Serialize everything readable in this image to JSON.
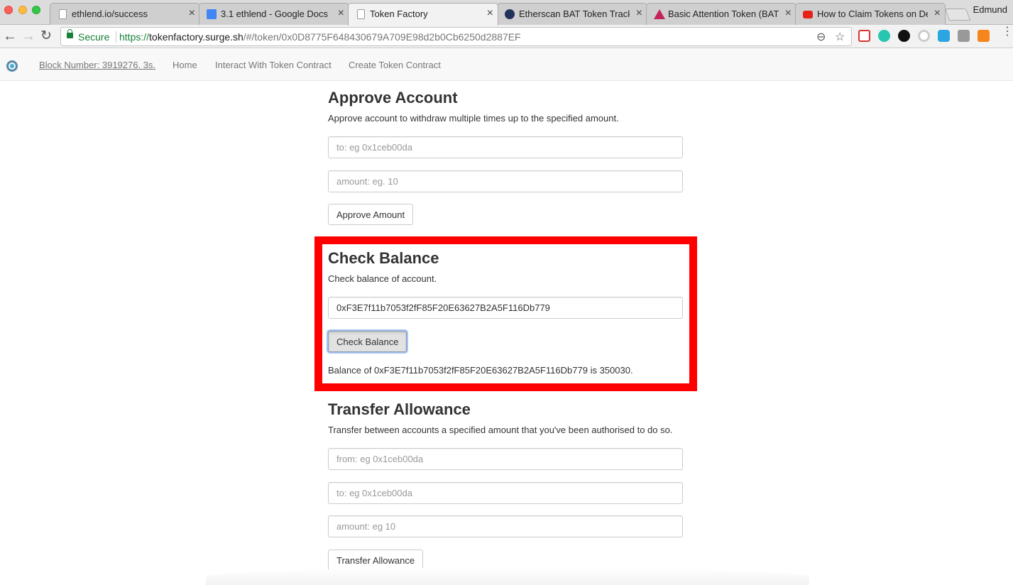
{
  "browser": {
    "tabs": [
      {
        "title": "ethlend.io/success",
        "active": false
      },
      {
        "title": "3.1 ethlend - Google Docs",
        "active": false
      },
      {
        "title": "Token Factory",
        "active": true
      },
      {
        "title": "Etherscan BAT Token Track",
        "active": false
      },
      {
        "title": "Basic Attention Token (BAT",
        "active": false
      },
      {
        "title": "How to Claim Tokens on De",
        "active": false
      }
    ],
    "profile_name": "Edmund",
    "secure_label": "Secure",
    "url_scheme": "https://",
    "url_host": "tokenfactory.surge.sh",
    "url_path": "/#/token/0x0D8775F648430679A709E98d2b0Cb6250d2887EF"
  },
  "nav": {
    "block_number": "Block Number: 3919276. 3s.",
    "home": "Home",
    "interact": "Interact With Token Contract",
    "create": "Create Token Contract"
  },
  "approve": {
    "title": "Approve Account",
    "description": "Approve account to withdraw multiple times up to the specified amount.",
    "to_placeholder": "to: eg 0x1ceb00da",
    "amount_placeholder": "amount: eg. 10",
    "button": "Approve Amount"
  },
  "check_balance": {
    "title": "Check Balance",
    "description": "Check balance of account.",
    "address_value": "0xF3E7f11b7053f2fF85F20E63627B2A5F116Db779",
    "button": "Check Balance",
    "result": "Balance of 0xF3E7f11b7053f2fF85F20E63627B2A5F116Db779 is 350030."
  },
  "transfer": {
    "title": "Transfer Allowance",
    "description": "Transfer between accounts a specified amount that you've been authorised to do so.",
    "from_placeholder": "from: eg 0x1ceb00da",
    "to_placeholder": "to: eg 0x1ceb00da",
    "amount_placeholder": "amount: eg 10",
    "button": "Transfer Allowance"
  },
  "colors": {
    "highlight": "#ff0000",
    "secure_green": "#188038"
  }
}
